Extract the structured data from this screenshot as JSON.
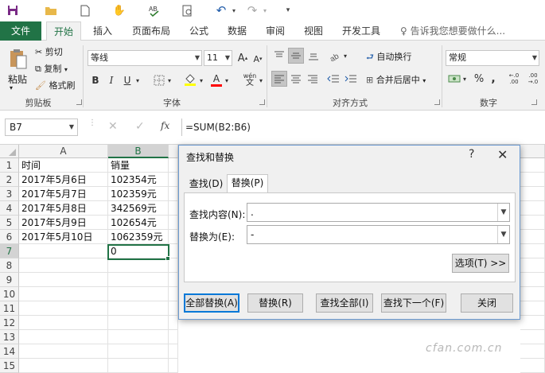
{
  "quick_access": {
    "items": [
      "save-icon",
      "open-folder-icon",
      "new-doc-icon",
      "touch-mode-icon",
      "spelling-icon",
      "print-preview-icon",
      "undo-icon",
      "redo-icon",
      "customize-icon"
    ]
  },
  "ribbon_tabs": [
    "文件",
    "开始",
    "插入",
    "页面布局",
    "公式",
    "数据",
    "审阅",
    "视图",
    "开发工具"
  ],
  "active_tab": "开始",
  "tell_me": "告诉我您想要做什么...",
  "clipboard": {
    "paste": "粘贴",
    "cut": "剪切",
    "copy": "复制",
    "format_painter": "格式刷",
    "group_label": "剪贴板"
  },
  "font": {
    "name": "等线",
    "size": "11",
    "bold": "B",
    "italic": "I",
    "underline": "U",
    "grow": "A",
    "shrink": "A",
    "wen": "wén",
    "font_color_letter": "A",
    "fill_color": "#ffff00",
    "font_color": "#ff0000",
    "group_label": "字体"
  },
  "alignment": {
    "wrap_text": "自动换行",
    "merge_center": "合并后居中",
    "group_label": "对齐方式"
  },
  "number": {
    "format": "常规",
    "percent": "%",
    "comma": ",",
    "inc_decimal": ".00",
    "dec_decimal": ".00",
    "group_label": "数字"
  },
  "formula_bar": {
    "name_box": "B7",
    "formula": "=SUM(B2:B6)",
    "fx": "fx"
  },
  "sheet": {
    "columns": [
      "A",
      "B"
    ],
    "rows": [
      "1",
      "2",
      "3",
      "4",
      "5",
      "6",
      "7",
      "8",
      "9",
      "10",
      "11",
      "12",
      "13",
      "14",
      "15"
    ],
    "cells": [
      {
        "a": "时间",
        "b": "销量"
      },
      {
        "a": "2017年5月6日",
        "b": "102354元"
      },
      {
        "a": "2017年5月7日",
        "b": "102359元"
      },
      {
        "a": "2017年5月8日",
        "b": "342569元"
      },
      {
        "a": "2017年5月9日",
        "b": "102654元"
      },
      {
        "a": "2017年5月10日",
        "b": "1062359元"
      },
      {
        "a": "",
        "b": "0"
      }
    ],
    "selected_cell": "B7",
    "accent": "#217346"
  },
  "dialog": {
    "title": "查找和替换",
    "help": "?",
    "close": "✕",
    "tabs": [
      "查找(D)",
      "替换(P)"
    ],
    "active_tab": "替换(P)",
    "find_label": "查找内容(N):",
    "find_value": ".",
    "replace_label": "替换为(E):",
    "replace_value": "-",
    "options_button": "选项(T) >>",
    "buttons": {
      "replace_all": "全部替换(A)",
      "replace": "替换(R)",
      "find_all": "查找全部(I)",
      "find_next": "查找下一个(F)",
      "close": "关闭"
    }
  },
  "watermark": "cfan.com.cn"
}
